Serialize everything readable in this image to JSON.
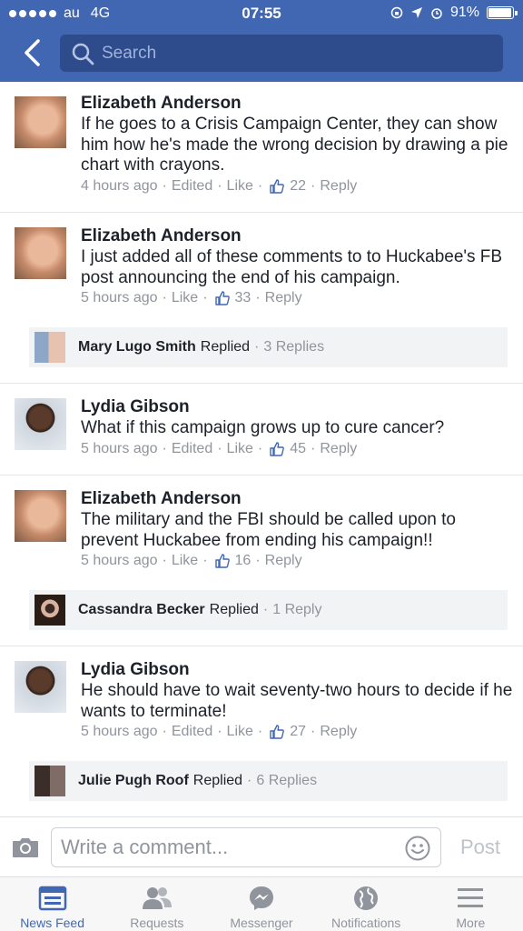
{
  "status_bar": {
    "carrier": "au",
    "network": "4G",
    "time": "07:55",
    "battery": "91%",
    "battery_level": 0.91
  },
  "header": {
    "search_placeholder": "Search"
  },
  "comments": [
    {
      "author": "Elizabeth Anderson",
      "text": "If he goes to a Crisis Campaign Center, they can show him how he's made the wrong decision by drawing a pie chart with crayons.",
      "time": "4 hours ago",
      "edited": "Edited",
      "like": "Like",
      "likes": "22",
      "reply": "Reply"
    },
    {
      "author": "Elizabeth Anderson",
      "text": "I just added all of these comments to to Huckabee's FB post announcing the end of his campaign.",
      "time": "5 hours ago",
      "like": "Like",
      "likes": "33",
      "reply": "Reply",
      "replied_by": "Mary Lugo Smith",
      "replied_label": "Replied",
      "replies_count": "3 Replies"
    },
    {
      "author": "Lydia Gibson",
      "text": "What if this campaign grows up to cure cancer?",
      "time": "5 hours ago",
      "edited": "Edited",
      "like": "Like",
      "likes": "45",
      "reply": "Reply"
    },
    {
      "author": "Elizabeth Anderson",
      "text": "The military and the FBI should be called upon to prevent Huckabee from ending his campaign!!",
      "time": "5 hours ago",
      "like": "Like",
      "likes": "16",
      "reply": "Reply",
      "replied_by": "Cassandra Becker",
      "replied_label": "Replied",
      "replies_count": "1 Reply"
    },
    {
      "author": "Lydia Gibson",
      "text": "He should have to wait seventy-two hours to decide if he wants to terminate!",
      "time": "5 hours ago",
      "edited": "Edited",
      "like": "Like",
      "likes": "27",
      "reply": "Reply",
      "replied_by": "Julie Pugh Roof",
      "replied_label": "Replied",
      "replies_count": "6 Replies"
    }
  ],
  "composer": {
    "placeholder": "Write a comment...",
    "post_label": "Post"
  },
  "tabs": [
    {
      "label": "News Feed",
      "icon": "news-feed-icon",
      "active": true
    },
    {
      "label": "Requests",
      "icon": "friend-requests-icon",
      "active": false
    },
    {
      "label": "Messenger",
      "icon": "messenger-icon",
      "active": false
    },
    {
      "label": "Notifications",
      "icon": "globe-icon",
      "active": false
    },
    {
      "label": "More",
      "icon": "menu-icon",
      "active": false
    }
  ],
  "colors": {
    "brand_blue": "#4267b2",
    "meta_gray": "#90949c"
  }
}
